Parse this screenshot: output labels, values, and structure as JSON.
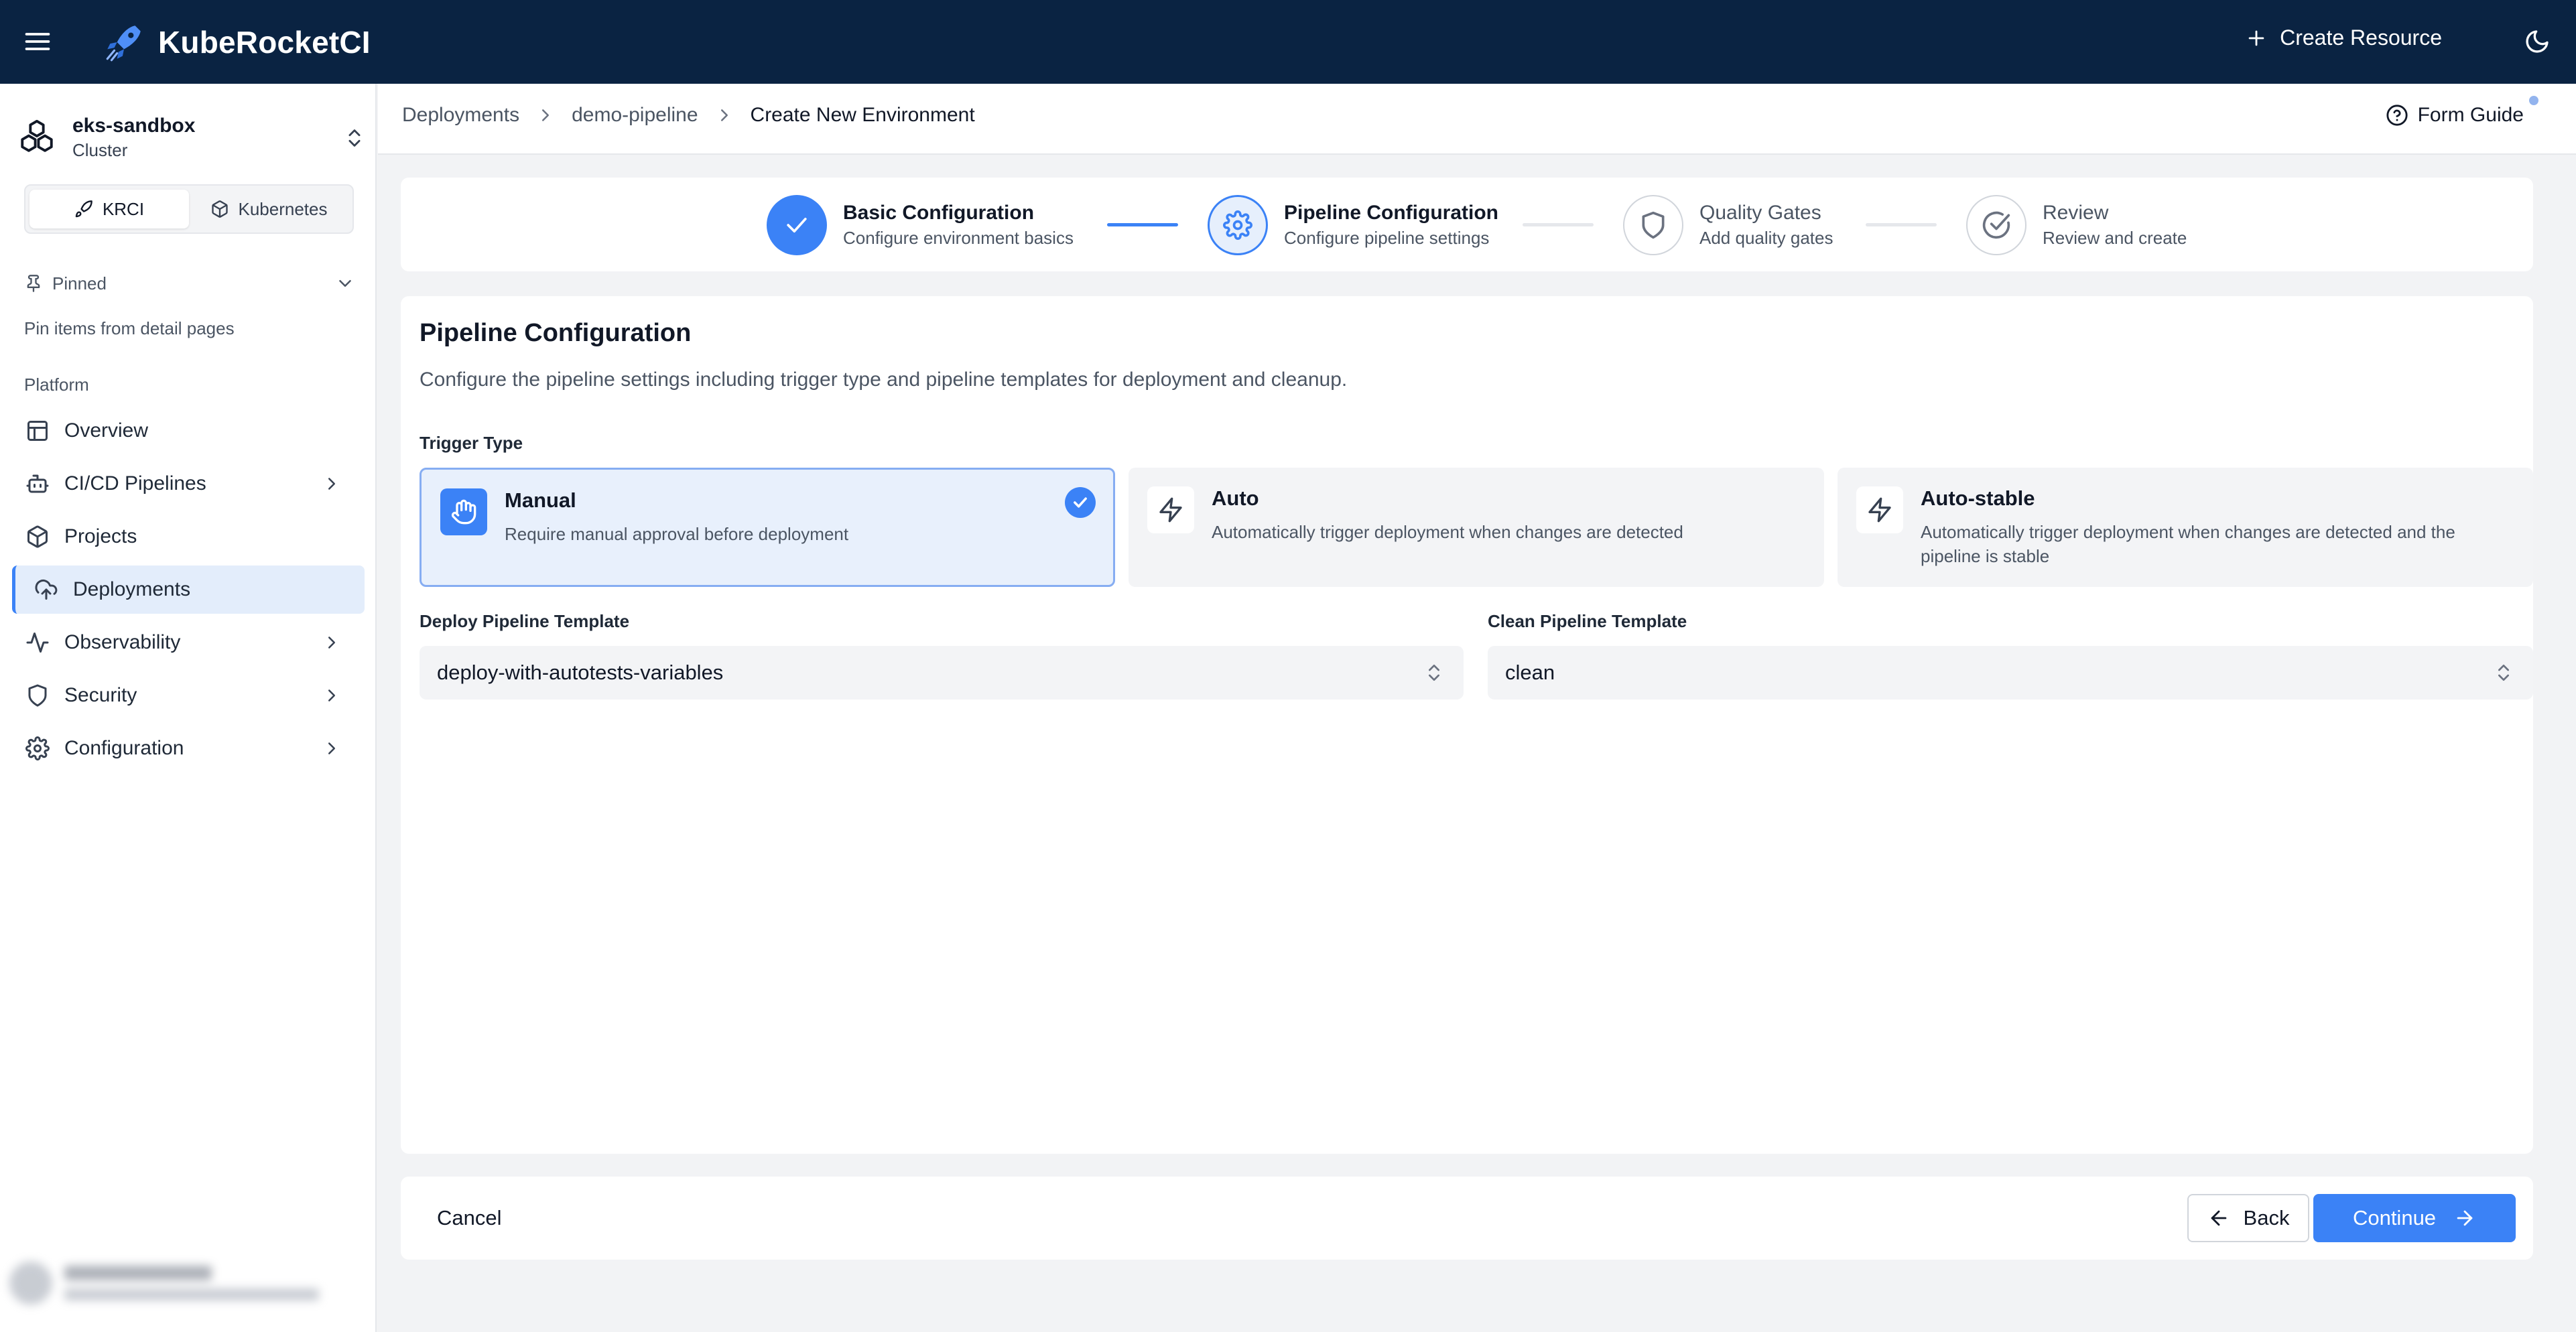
{
  "topbar": {
    "app_title": "KubeRocketCI",
    "create_resource_label": "Create Resource",
    "icons": [
      "hamburger-menu-icon",
      "rocket-logo-icon",
      "plus-icon",
      "moon-icon"
    ]
  },
  "sidebar": {
    "cluster": {
      "name": "eks-sandbox",
      "type": "Cluster"
    },
    "view_toggle": [
      {
        "label": "KRCI",
        "active": true,
        "icon": "rocket-icon"
      },
      {
        "label": "Kubernetes",
        "active": false,
        "icon": "cube-icon"
      }
    ],
    "pinned": {
      "label": "Pinned",
      "hint": "Pin items from detail pages"
    },
    "section_label": "Platform",
    "items": [
      {
        "label": "Overview",
        "icon": "layout-icon",
        "has_children": false,
        "active": false
      },
      {
        "label": "CI/CD Pipelines",
        "icon": "bot-icon",
        "has_children": true,
        "active": false
      },
      {
        "label": "Projects",
        "icon": "box-icon",
        "has_children": false,
        "active": false
      },
      {
        "label": "Deployments",
        "icon": "cloud-upload-icon",
        "has_children": false,
        "active": true
      },
      {
        "label": "Observability",
        "icon": "activity-icon",
        "has_children": true,
        "active": false
      },
      {
        "label": "Security",
        "icon": "shield-icon",
        "has_children": true,
        "active": false
      },
      {
        "label": "Configuration",
        "icon": "gear-icon",
        "has_children": true,
        "active": false
      }
    ]
  },
  "breadcrumb": {
    "items": [
      "Deployments",
      "demo-pipeline"
    ],
    "current": "Create New Environment"
  },
  "form_guide": {
    "label": "Form Guide"
  },
  "stepper": {
    "steps": [
      {
        "title": "Basic Configuration",
        "subtitle": "Configure environment basics",
        "state": "done"
      },
      {
        "title": "Pipeline Configuration",
        "subtitle": "Configure pipeline settings",
        "state": "current"
      },
      {
        "title": "Quality Gates",
        "subtitle": "Add quality gates",
        "state": "todo"
      },
      {
        "title": "Review",
        "subtitle": "Review and create",
        "state": "todo"
      }
    ]
  },
  "form": {
    "title": "Pipeline Configuration",
    "description": "Configure the pipeline settings including trigger type and pipeline templates for deployment and cleanup.",
    "trigger_type_label": "Trigger Type",
    "trigger_options": [
      {
        "title": "Manual",
        "description": "Require manual approval before deployment",
        "selected": true,
        "icon": "hand-icon"
      },
      {
        "title": "Auto",
        "description": "Automatically trigger deployment when changes are detected",
        "selected": false,
        "icon": "lightning-icon"
      },
      {
        "title": "Auto-stable",
        "description": "Automatically trigger deployment when changes are detected and the pipeline is stable",
        "selected": false,
        "icon": "lightning-icon"
      }
    ],
    "deploy_template": {
      "label": "Deploy Pipeline Template",
      "value": "deploy-with-autotests-variables"
    },
    "clean_template": {
      "label": "Clean Pipeline Template",
      "value": "clean"
    }
  },
  "footer": {
    "cancel_label": "Cancel",
    "back_label": "Back",
    "continue_label": "Continue"
  },
  "colors": {
    "topbar_bg": "#0a2342",
    "accent": "#3b82f6",
    "selected_card_bg": "#e8f0fc",
    "page_bg": "#f2f3f5"
  }
}
